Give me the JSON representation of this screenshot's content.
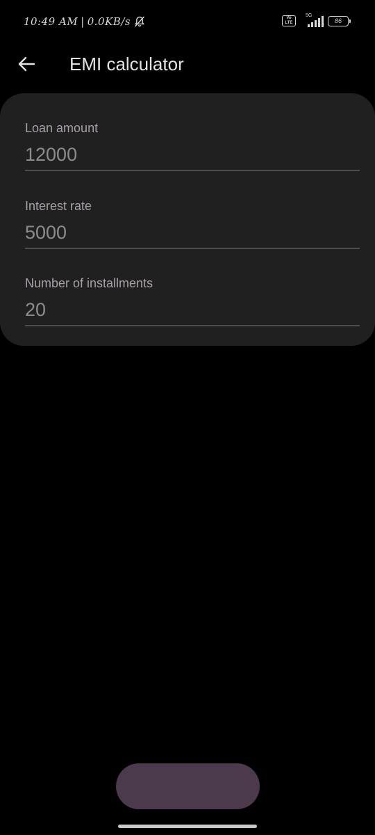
{
  "status_bar": {
    "time": "10:49 AM",
    "separator": "|",
    "network_speed": "0.0KB/s",
    "volte_top": "Vo",
    "volte_bottom": "LTE",
    "network_type": "5G",
    "battery": "86",
    "icons": [
      "bell-off-icon",
      "volte-icon",
      "signal-icon",
      "battery-icon"
    ]
  },
  "app_bar": {
    "title": "EMI calculator",
    "back_icon": "arrow-left-icon"
  },
  "form": {
    "loan_amount": {
      "label": "Loan amount",
      "value": "12000"
    },
    "interest_rate": {
      "label": "Interest rate",
      "value": "5000"
    },
    "installments": {
      "label": "Number of installments",
      "value": "20"
    }
  },
  "colors": {
    "background": "#000000",
    "card": "#202020",
    "button": "#4b3a4c",
    "label": "#a8a0a8",
    "value": "#8f8a8f"
  }
}
